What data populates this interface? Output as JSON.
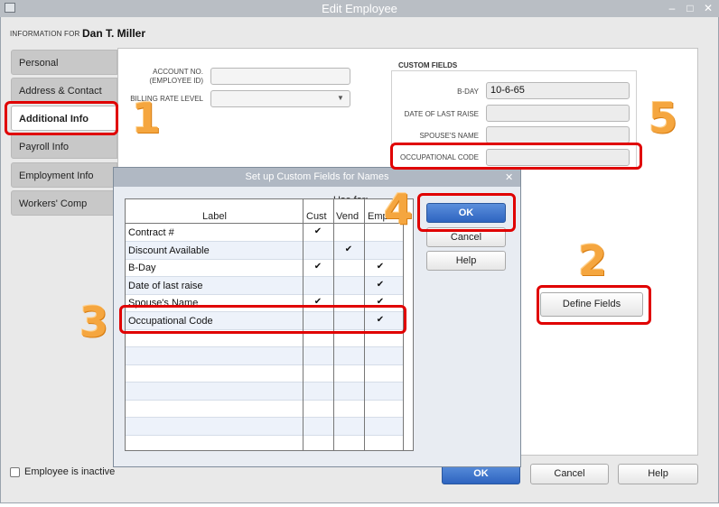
{
  "window": {
    "title": "Edit Employee",
    "minimize": "–",
    "maximize": "□",
    "close": "✕"
  },
  "employee": {
    "info_label": "INFORMATION FOR",
    "name": "Dan T. Miller"
  },
  "tabs": [
    {
      "label": "Personal"
    },
    {
      "label": "Address & Contact"
    },
    {
      "label": "Additional Info"
    },
    {
      "label": "Payroll Info"
    },
    {
      "label": "Employment Info"
    },
    {
      "label": "Workers' Comp"
    }
  ],
  "fields": {
    "account_label_1": "ACCOUNT NO.",
    "account_label_2": "(EMPLOYEE ID)",
    "account_value": "",
    "billing_label": "BILLING RATE LEVEL",
    "billing_value": ""
  },
  "custom_fields": {
    "title": "CUSTOM FIELDS",
    "items": [
      {
        "label": "B-DAY",
        "value": "10-6-65"
      },
      {
        "label": "DATE OF LAST RAISE",
        "value": ""
      },
      {
        "label": "SPOUSE'S NAME",
        "value": ""
      },
      {
        "label": "OCCUPATIONAL CODE",
        "value": ""
      }
    ],
    "define_button": "Define Fields"
  },
  "footer": {
    "inactive_label": "Employee is inactive",
    "ok": "OK",
    "cancel": "Cancel",
    "help": "Help"
  },
  "dialog": {
    "title": "Set up Custom Fields for Names",
    "close": "✕",
    "use_for": "Use for:",
    "columns": {
      "label": "Label",
      "cust": "Cust",
      "vend": "Vend",
      "empl": "Empl"
    },
    "rows": [
      {
        "label": "Contract #",
        "cust": "✔",
        "vend": "",
        "empl": ""
      },
      {
        "label": "Discount Available",
        "cust": "",
        "vend": "✔",
        "empl": ""
      },
      {
        "label": "B-Day",
        "cust": "✔",
        "vend": "",
        "empl": "✔"
      },
      {
        "label": "Date of last raise",
        "cust": "",
        "vend": "",
        "empl": "✔"
      },
      {
        "label": "Spouse's Name",
        "cust": "✔",
        "vend": "",
        "empl": "✔"
      },
      {
        "label": "Occupational Code",
        "cust": "",
        "vend": "",
        "empl": "✔"
      }
    ],
    "ok": "OK",
    "cancel": "Cancel",
    "help": "Help"
  },
  "annotations": {
    "n1": "1",
    "n2": "2",
    "n3": "3",
    "n4": "4",
    "n5": "5"
  },
  "colors": {
    "highlight": "#e00000",
    "callout": "#f5a63f",
    "primary": "#2e64c0"
  }
}
